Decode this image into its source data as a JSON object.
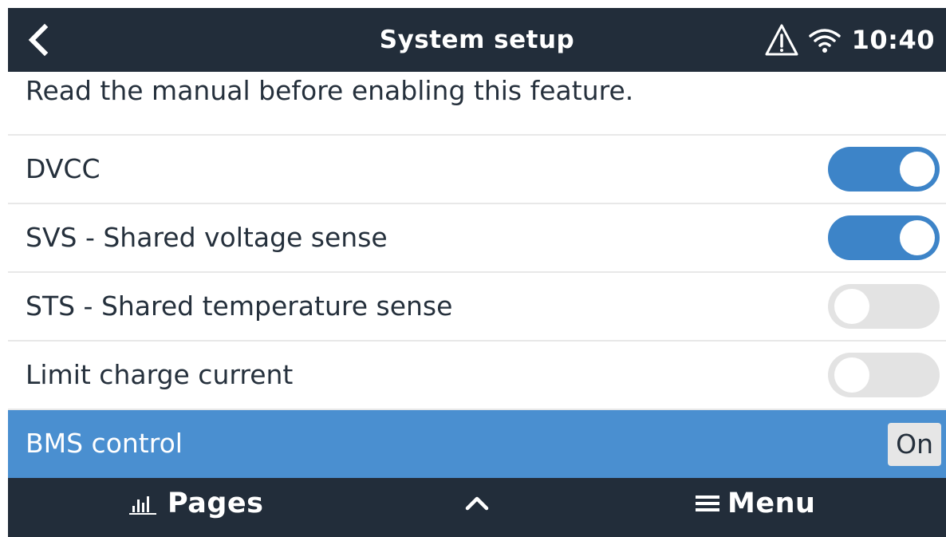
{
  "header": {
    "title": "System setup",
    "clock": "10:40",
    "icons": {
      "back": "back-chevron-icon",
      "alarm": "warning-triangle-icon",
      "wifi": "wifi-icon"
    }
  },
  "notice": "Read the manual before enabling this feature.",
  "settings": [
    {
      "label": "DVCC",
      "type": "toggle",
      "checked": true
    },
    {
      "label": "SVS - Shared voltage sense",
      "type": "toggle",
      "checked": true
    },
    {
      "label": "STS - Shared temperature sense",
      "type": "toggle",
      "checked": false
    },
    {
      "label": "Limit charge current",
      "type": "toggle",
      "checked": false
    },
    {
      "label": "BMS control",
      "type": "value",
      "value": "On",
      "selected": true
    }
  ],
  "footer": {
    "pages_label": "Pages",
    "menu_label": "Menu",
    "icons": {
      "pages": "bar-chart-icon",
      "up": "chevron-up-icon",
      "menu": "hamburger-menu-icon"
    }
  },
  "colors": {
    "bar_background": "#222d3a",
    "accent_blue": "#3d84c8",
    "selected_row": "#4a8fd0",
    "toggle_off": "#e3e3e3"
  }
}
